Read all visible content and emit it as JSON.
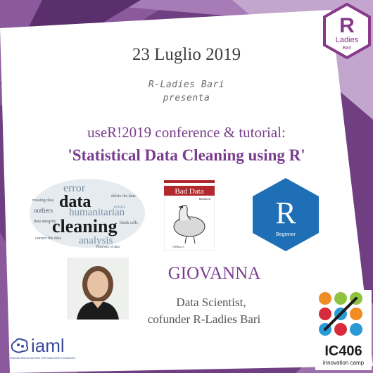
{
  "event": {
    "date": "23 Luglio 2019",
    "organizer": "R-Ladies Bari",
    "presents": "presenta",
    "conference_line": "useR!2019 conference & tutorial:",
    "tutorial_title": "'Statistical Data Cleaning using R'"
  },
  "speaker": {
    "name": "GIOVANNA",
    "role_line1": "Data Scientist,",
    "role_line2": "cofunder R-Ladies Bari"
  },
  "rladies_logo": {
    "letter": "R",
    "text1": "Ladies",
    "text2": "Bari"
  },
  "wordcloud": {
    "words": [
      "error",
      "data",
      "humanitarian",
      "cleaning",
      "analysis",
      "missing data",
      "outliers",
      "correct the data",
      "delete the data",
      "treatment of data",
      "blank cells",
      "data integrity",
      "errors"
    ]
  },
  "book": {
    "title": "Bad Data",
    "subtitle": "Handbook",
    "publisher": "O'REILLY"
  },
  "r_beginner": {
    "letter": "R",
    "label": "Beginner"
  },
  "iaml": {
    "name": "iaml",
    "tagline": "ITALIAN ASSOCIATION FOR MACHINE LEARNING"
  },
  "ic406": {
    "name": "IC406",
    "tagline": "innovation camp"
  },
  "colors": {
    "purple_dark": "#6f3f82",
    "purple_text": "#7a3d8e",
    "panel": "#ffffff"
  }
}
